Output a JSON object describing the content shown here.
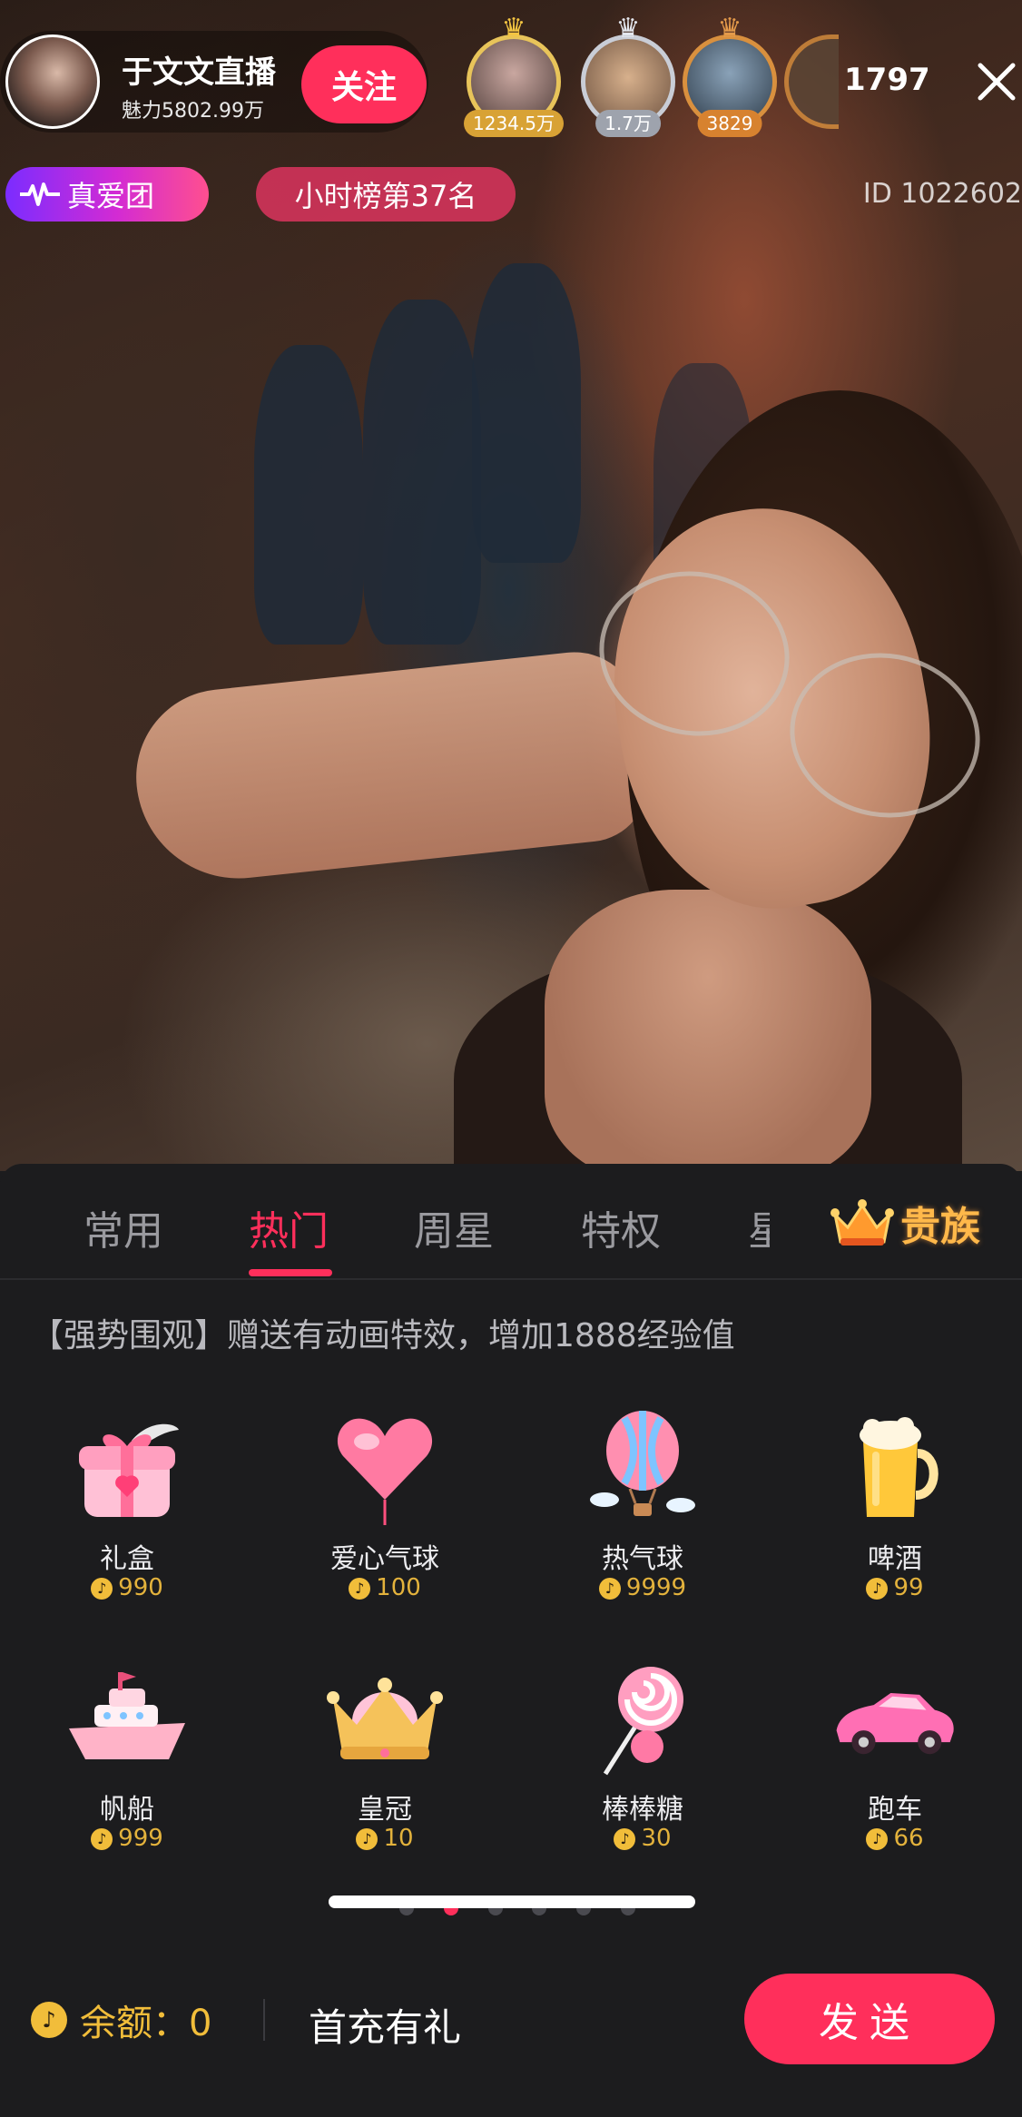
{
  "host": {
    "name": "于文文直播",
    "charm": "魅力5802.99万",
    "follow_label": "关注"
  },
  "viewers": [
    {
      "badge": "1234.5万",
      "tier": "gold"
    },
    {
      "badge": "1.7万",
      "tier": "silver"
    },
    {
      "badge": "3829",
      "tier": "bronze"
    }
  ],
  "viewer_count": "1797",
  "badges": {
    "fan_club": "真爱团",
    "rank": "小时榜第37名"
  },
  "room_id": "ID 1022602",
  "tabs": {
    "items": [
      "常用",
      "热门",
      "周星",
      "特权"
    ],
    "active": "热门",
    "noble": "贵族"
  },
  "gift_description": "【强势围观】赠送有动画特效，增加1888经验值",
  "gifts": [
    {
      "name": "礼盒",
      "price": "990",
      "icon": "gift-box-icon"
    },
    {
      "name": "爱心气球",
      "price": "100",
      "icon": "heart-balloon-icon"
    },
    {
      "name": "热气球",
      "price": "9999",
      "icon": "hot-air-balloon-icon"
    },
    {
      "name": "啤酒",
      "price": "99",
      "icon": "beer-icon"
    },
    {
      "name": "帆船",
      "price": "999",
      "icon": "ship-icon"
    },
    {
      "name": "皇冠",
      "price": "10",
      "icon": "crown-icon"
    },
    {
      "name": "棒棒糖",
      "price": "30",
      "icon": "lollipop-icon"
    },
    {
      "name": "跑车",
      "price": "66",
      "icon": "sports-car-icon"
    }
  ],
  "pagination": {
    "pages": 6,
    "current": 2
  },
  "footer": {
    "balance_label": "余额：0",
    "first_charge": "首充有礼",
    "send_label": "发送"
  },
  "colors": {
    "accent": "#ff2f5b",
    "gold": "#f1bd3a",
    "panel_bg": "#1c1c1e"
  }
}
